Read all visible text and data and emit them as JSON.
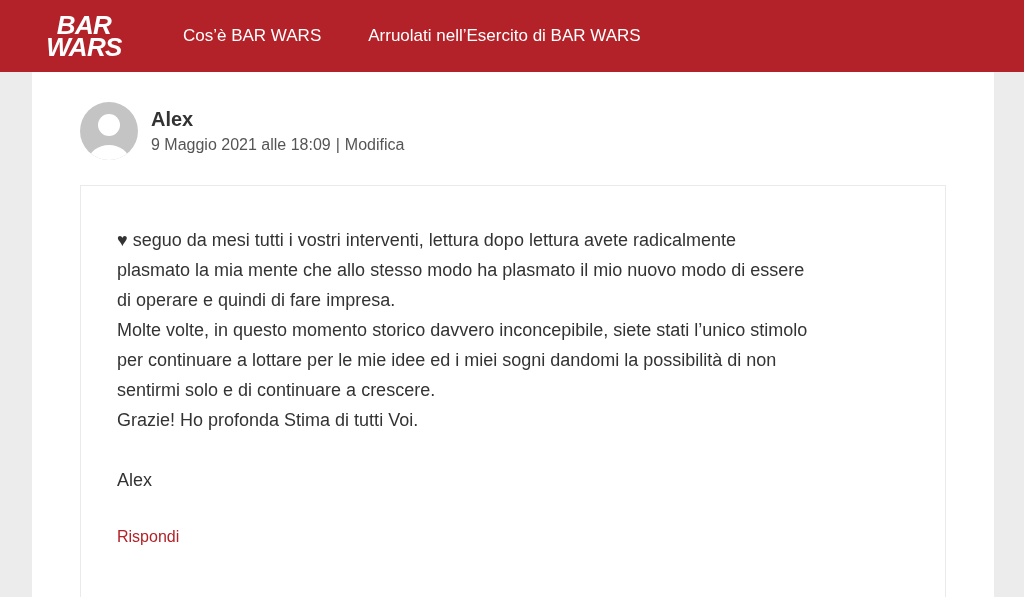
{
  "header": {
    "logo": [
      "BAR",
      "WARS"
    ],
    "nav": [
      "Cos’è BAR WARS",
      "Arruolati nell’Esercito di BAR WARS"
    ]
  },
  "comment": {
    "author": "Alex",
    "date": "9 Maggio 2021 alle 18:09",
    "separator": "|",
    "edit_link": "Modifica",
    "lines": [
      "♥ seguo da mesi tutti i vostri interventi, lettura dopo lettura avete radicalmente",
      "plasmato la mia mente che allo stesso modo ha plasmato il mio nuovo modo di essere",
      "di operare e quindi di fare impresa.",
      "Molte volte, in questo momento storico davvero inconcepibile, siete stati l’unico stimolo",
      "per continuare a lottare per le mie idee ed i miei sogni dandomi la possibilità di non",
      "sentirmi solo e di continuare a crescere.",
      "Grazie! Ho profonda Stima di tutti Voi."
    ],
    "signature": "Alex",
    "reply_link": "Rispondi"
  }
}
